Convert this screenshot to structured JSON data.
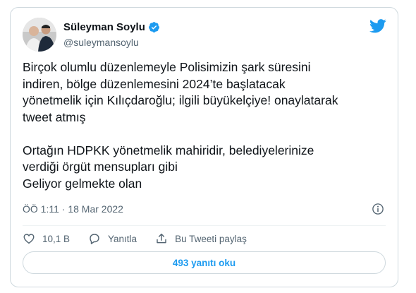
{
  "author": {
    "name": "Süleyman Soylu",
    "handle": "@suleymansoylu",
    "verified": true
  },
  "tweet": {
    "lines_p1": [
      "Birçok olumlu düzenlemeyle Polisimizin şark süresini",
      "indiren, bölge düzenlemesini 2024’te başlatacak",
      "yönetmelik için Kılıçdaroğlu; ilgili büyükelçiye! onaylatarak",
      "tweet atmış"
    ],
    "lines_p2": [
      "Ortağın HDPKK yönetmelik mahiridir, belediyelerinize",
      "verdiği örgüt mensupları gibi",
      "Geliyor gelmekte olan"
    ],
    "timestamp": "ÖÖ 1:11 · 18 Mar 2022"
  },
  "actions": {
    "like_count": "10,1 B",
    "reply_label": "Yanıtla",
    "share_label": "Bu Tweeti paylaş"
  },
  "replies_button": "493 yanıtı oku",
  "colors": {
    "accent": "#1d9bf0",
    "text": "#0f1419",
    "muted": "#536471",
    "border": "#cfd9de"
  },
  "icons": [
    "verified-badge-icon",
    "twitter-bird-icon",
    "info-icon",
    "heart-icon",
    "reply-icon",
    "share-icon"
  ]
}
